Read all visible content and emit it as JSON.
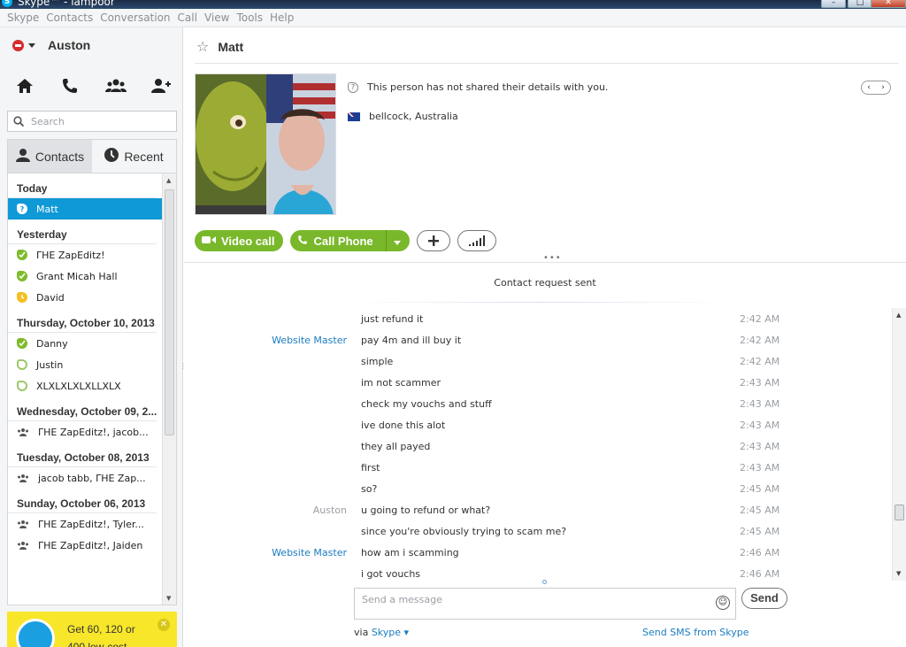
{
  "window": {
    "title": "Skype™ - lampoor"
  },
  "menu": [
    "Skype",
    "Contacts",
    "Conversation",
    "Call",
    "View",
    "Tools",
    "Help"
  ],
  "profile": {
    "name": "Auston",
    "status_color": "#d92b2b"
  },
  "nav_icons": [
    "home-icon",
    "phone-icon",
    "group-icon",
    "add-contact-icon"
  ],
  "search": {
    "placeholder": "Search"
  },
  "tabs": {
    "contacts": "Contacts",
    "recent": "Recent"
  },
  "recent_groups": [
    {
      "header": "Today",
      "items": [
        {
          "name": "Matt",
          "status": "unknown",
          "selected": true
        }
      ]
    },
    {
      "header": "Yesterday",
      "items": [
        {
          "name": "ΓΗΕ ZapEditz!",
          "status": "online"
        },
        {
          "name": "Grant Micah Hall",
          "status": "online"
        },
        {
          "name": "David",
          "status": "away"
        }
      ]
    },
    {
      "header": "Thursday, October 10, 2013",
      "items": [
        {
          "name": "Danny",
          "status": "online"
        },
        {
          "name": "Justin",
          "status": "offline"
        },
        {
          "name": "XLXLXLXLXLLXLX",
          "status": "offline"
        }
      ]
    },
    {
      "header": "Wednesday, October 09, 2...",
      "items": [
        {
          "name": "ΓΗΕ ZapEditz!, jacob...",
          "status": "group"
        }
      ]
    },
    {
      "header": "Tuesday, October 08, 2013",
      "items": [
        {
          "name": "jacob tabb, ΓΗΕ Zap...",
          "status": "group"
        }
      ]
    },
    {
      "header": "Sunday, October 06, 2013",
      "items": [
        {
          "name": "ΓΗΕ ZapEditz!, Tyler...",
          "status": "group"
        },
        {
          "name": "ΓΗΕ ZapEditz!, Jaiden",
          "status": "group"
        }
      ]
    }
  ],
  "promo": {
    "line1": "Get 60, 120 or",
    "line2": "400 low-cost...",
    "bg_color": "#f7e62a"
  },
  "contact": {
    "name": "Matt",
    "info": "This person has not shared their details with you.",
    "location": "bellcock, Australia"
  },
  "actions": {
    "video_call": "Video call",
    "call_phone": "Call Phone",
    "accent_color": "#7ab82b"
  },
  "chat": {
    "notice": "Contact request sent",
    "messages": [
      {
        "sender": "",
        "text": "just refund it",
        "time": "2:42 AM"
      },
      {
        "sender": "Website Master",
        "text": "pay 4m and ill buy it",
        "time": "2:42 AM",
        "sender_type": "other"
      },
      {
        "sender": "",
        "text": "simple",
        "time": "2:42 AM"
      },
      {
        "sender": "",
        "text": "im not scammer",
        "time": "2:43 AM"
      },
      {
        "sender": "",
        "text": "check my vouchs and stuff",
        "time": "2:43 AM"
      },
      {
        "sender": "",
        "text": "ive done this alot",
        "time": "2:43 AM"
      },
      {
        "sender": "",
        "text": "they all payed",
        "time": "2:43 AM"
      },
      {
        "sender": "",
        "text": "first",
        "time": "2:43 AM"
      },
      {
        "sender": "",
        "text": "so?",
        "time": "2:45 AM"
      },
      {
        "sender": "Auston",
        "text": "u going to refund or what?",
        "time": "2:45 AM",
        "sender_type": "self"
      },
      {
        "sender": "",
        "text": "since you're obviously trying to scam me?",
        "time": "2:45 AM"
      },
      {
        "sender": "Website Master",
        "text": "how am i scamming",
        "time": "2:46 AM",
        "sender_type": "other"
      },
      {
        "sender": "",
        "text": "i got vouchs",
        "time": "2:46 AM"
      }
    ]
  },
  "compose": {
    "placeholder": "Send a message",
    "send_label": "Send",
    "via_label": "via",
    "via_link": "Skype",
    "sms_link": "Send SMS from Skype"
  }
}
